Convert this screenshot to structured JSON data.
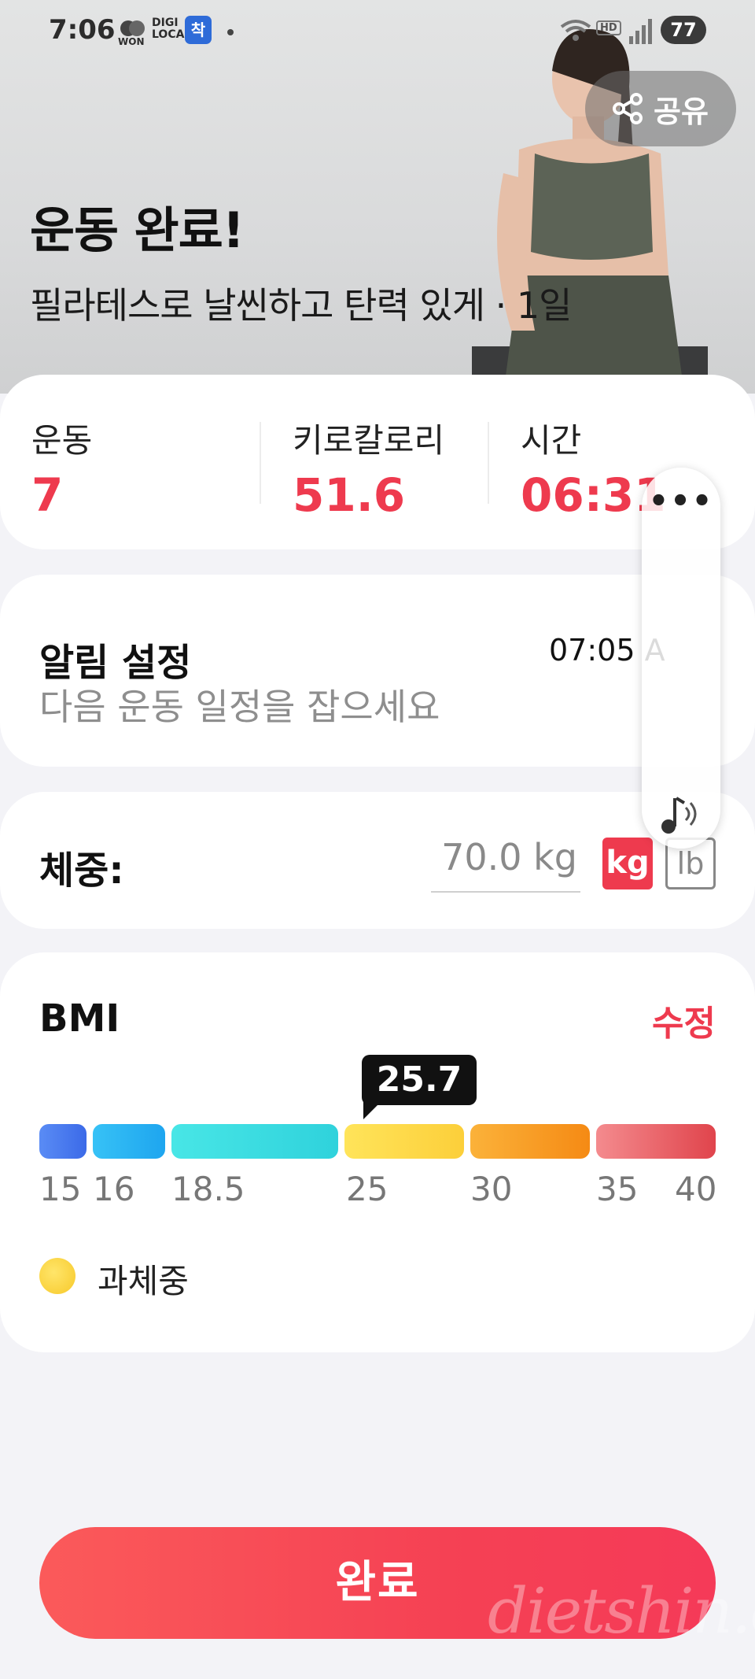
{
  "status_bar": {
    "time": "7:06",
    "won_label": "WON",
    "digi_label": "DIGI\nLOCA",
    "chak_label": "착",
    "hd_label": "HD",
    "battery": "77"
  },
  "hero": {
    "share_label": "공유",
    "title": "운동 완료!",
    "subtitle": "필라테스로 날씬하고 탄력 있게 · 1일"
  },
  "stats": {
    "exercise_label": "운동",
    "exercise_value": "7",
    "kcal_label": "키로칼로리",
    "kcal_value": "51.6",
    "time_label": "시간",
    "time_value": "06:31"
  },
  "alarm": {
    "title": "알림 설정",
    "time": "07:05 A",
    "subtitle": "다음 운동 일정을 잡으세요"
  },
  "weight": {
    "label": "체중:",
    "value": "70.0 kg",
    "unit_kg": "kg",
    "unit_lb": "lb"
  },
  "bmi": {
    "title": "BMI",
    "edit_label": "수정",
    "value": "25.7",
    "ticks": [
      "15",
      "16",
      "18.5",
      "25",
      "30",
      "35",
      "40"
    ],
    "legend_label": "과체중",
    "colors": {
      "underweight_severe": "#4a7cf0",
      "underweight": "#2eb5f2",
      "normal": "#3fdde0",
      "overweight": "#fcd84a",
      "obese": "#f79a24",
      "severe": "#e8505a"
    }
  },
  "footer": {
    "done_label": "완료",
    "watermark": "dietshin.com"
  },
  "colors": {
    "accent": "#ee3a4e"
  }
}
